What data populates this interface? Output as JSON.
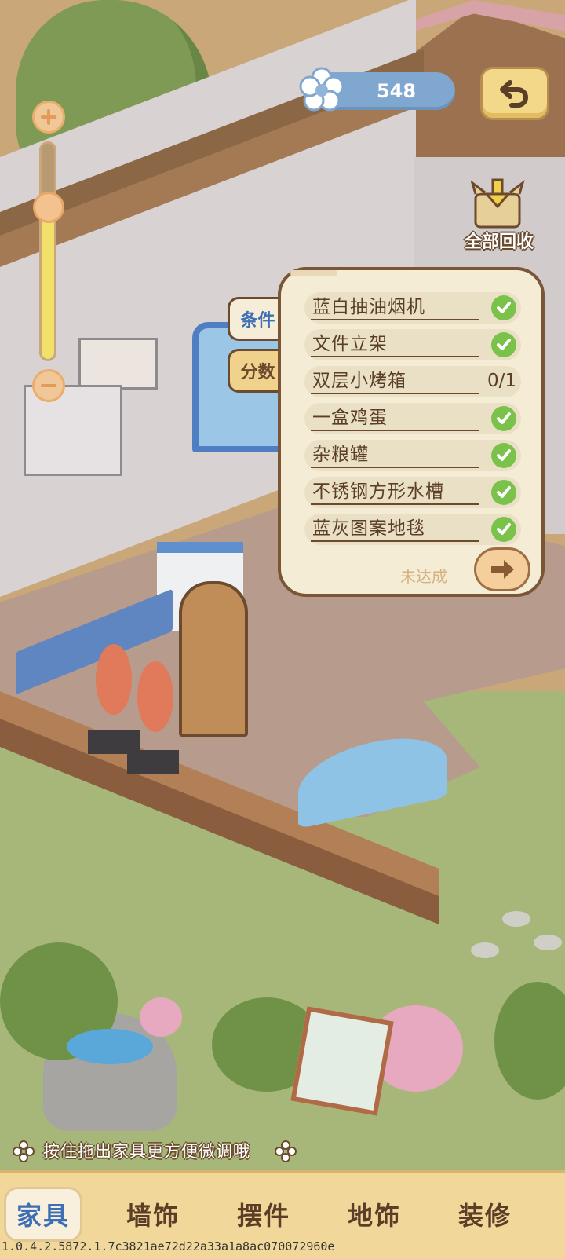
{
  "currency": {
    "value": "548",
    "icon": "flower-icon"
  },
  "recycle": {
    "label": "全部回收",
    "icon": "box-icon"
  },
  "zoom": {
    "level": 0.7
  },
  "tabs": [
    {
      "label": "条件",
      "active": true
    },
    {
      "label": "分数",
      "active": false
    }
  ],
  "conditions": [
    {
      "label": "蓝白抽油烟机",
      "done": true
    },
    {
      "label": "文件立架",
      "done": true
    },
    {
      "label": "双层小烤箱",
      "done": false,
      "progress": "0/1"
    },
    {
      "label": "一盒鸡蛋",
      "done": true
    },
    {
      "label": "杂粮罐",
      "done": true
    },
    {
      "label": "不锈钢方形水槽",
      "done": true
    },
    {
      "label": "蓝灰图案地毯",
      "done": true
    }
  ],
  "status": "未达成",
  "hint": "按住拖出家具更方便微调哦",
  "nav": [
    {
      "label": "家具",
      "active": true
    },
    {
      "label": "墙饰",
      "active": false
    },
    {
      "label": "摆件",
      "active": false
    },
    {
      "label": "地饰",
      "active": false
    },
    {
      "label": "装修",
      "active": false
    }
  ],
  "version": "1.0.4.2.5872.1.7c3821ae72d22a33a1a8ac070072960e",
  "colors": {
    "accent": "#3d6fb6",
    "check": "#7bc24b",
    "panel": "#f5ecd6"
  }
}
